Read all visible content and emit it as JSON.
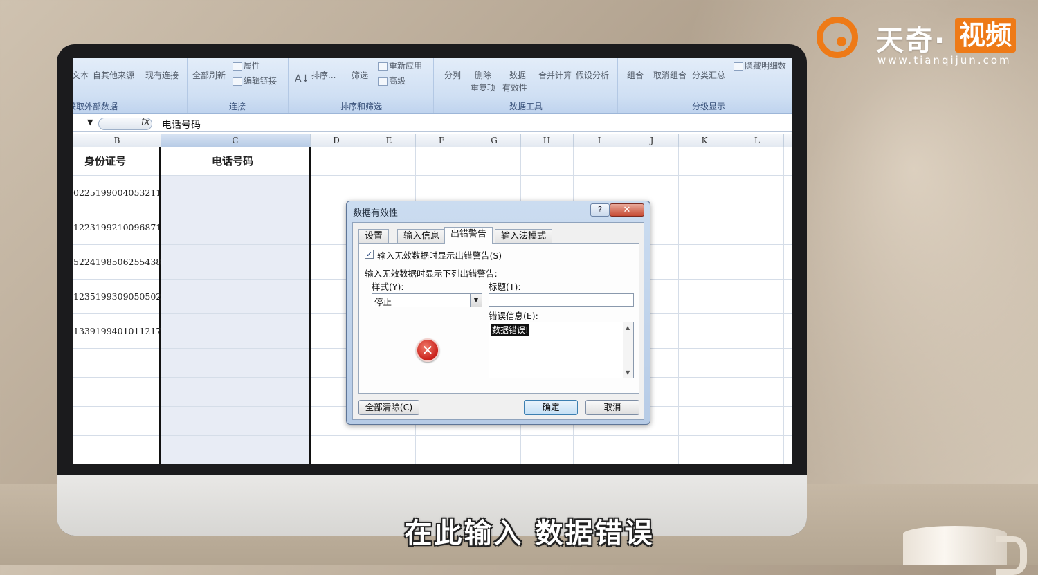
{
  "logo": {
    "brand": "天奇·",
    "badge": "视频",
    "url": "www.tianqijun.com"
  },
  "ribbon": {
    "groups": [
      {
        "label": "获取外部数据",
        "buttons": [
          "文本",
          "自其他来源",
          "现有连接"
        ]
      },
      {
        "label": "连接",
        "buttons": [
          "全部刷新",
          "属性",
          "编辑链接"
        ]
      },
      {
        "label": "排序和筛选",
        "buttons": [
          "排序...",
          "筛选",
          "重新应用",
          "高级"
        ]
      },
      {
        "label": "数据工具",
        "buttons": [
          "分列",
          "删除",
          "重复项",
          "数据",
          "有效性",
          "合并计算",
          "假设分析"
        ]
      },
      {
        "label": "分级显示",
        "buttons": [
          "组合",
          "取消组合",
          "分类汇总",
          "隐藏明细数"
        ]
      }
    ]
  },
  "formula_bar": {
    "fx": "fx",
    "value": "电话号码"
  },
  "columns": [
    "B",
    "C",
    "D",
    "E",
    "F",
    "G",
    "H",
    "I",
    "J",
    "K",
    "L"
  ],
  "sheet": {
    "header_b": "身份证号",
    "header_c": "电话号码",
    "ids": [
      "0225199004053211",
      "1223199210096871",
      "5224198506255438",
      "1235199309050502",
      "1339199401011217"
    ]
  },
  "dialog": {
    "title": "数据有效性",
    "help": "?",
    "close": "✕",
    "tabs": [
      "设置",
      "输入信息",
      "出错警告",
      "输入法模式"
    ],
    "active_tab": "出错警告",
    "checkbox_label": "输入无效数据时显示出错警告(S)",
    "checkbox_checked": true,
    "section_label": "输入无效数据时显示下列出错警告:",
    "style_label": "样式(Y):",
    "style_value": "停止",
    "title_label": "标题(T):",
    "title_value": "",
    "error_label": "错误信息(E):",
    "error_value": "数据错误!",
    "clear_all": "全部清除(C)",
    "ok": "确定",
    "cancel": "取消"
  },
  "subtitle": "在此输入 数据错误"
}
